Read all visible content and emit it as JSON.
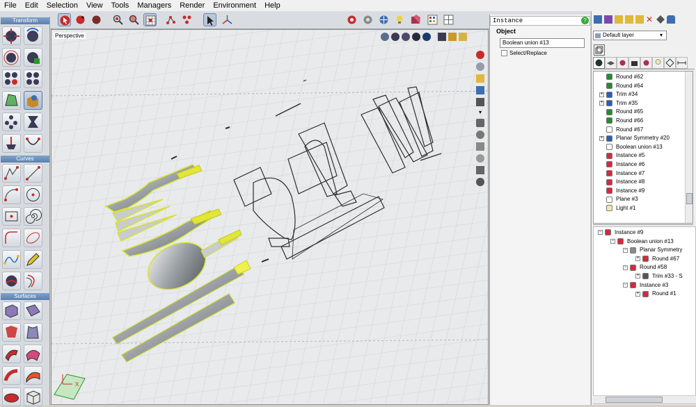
{
  "menu": {
    "items": [
      "File",
      "Edit",
      "Selection",
      "View",
      "Tools",
      "Managers",
      "Render",
      "Environment",
      "Help"
    ]
  },
  "toolbar_left": {
    "sections": [
      {
        "label": "Transform"
      },
      {
        "label": "Curves"
      },
      {
        "label": "Surfaces"
      }
    ]
  },
  "viewport": {
    "label": "Perspective"
  },
  "instance_panel": {
    "title": "Instance",
    "object_label": "Object",
    "object_name": "Boolean union #13",
    "select_replace": "Select/Replace"
  },
  "right_panel": {
    "layer": "Default layer",
    "browser_items": [
      {
        "label": "Round #62",
        "icon": "arrow-icon",
        "color": "#1e8f2d",
        "expand": false
      },
      {
        "label": "Round #64",
        "icon": "arrow-icon",
        "color": "#1e8f2d",
        "expand": false
      },
      {
        "label": "Trim #34",
        "icon": "trim-icon",
        "color": "#2a5fb8",
        "expand": true
      },
      {
        "label": "Trim #35",
        "icon": "trim-icon",
        "color": "#2a5fb8",
        "expand": true
      },
      {
        "label": "Round #65",
        "icon": "arrow-icon",
        "color": "#1e8f2d",
        "expand": false
      },
      {
        "label": "Round #66",
        "icon": "arrow-icon",
        "color": "#1e8f2d",
        "expand": false
      },
      {
        "label": "Round #67",
        "icon": "square-icon",
        "color": "#ffffff",
        "expand": false
      },
      {
        "label": "Planar Symmetry #20",
        "icon": "planar-icon",
        "color": "#2a5fb8",
        "expand": true
      },
      {
        "label": "Boolean union #13",
        "icon": "square-icon",
        "color": "#ffffff",
        "expand": false
      },
      {
        "label": "Instance #5",
        "icon": "cube-icon",
        "color": "#d8283d",
        "expand": false
      },
      {
        "label": "Instance #6",
        "icon": "cube-icon",
        "color": "#d8283d",
        "expand": false
      },
      {
        "label": "Instance #7",
        "icon": "cube-icon",
        "color": "#d8283d",
        "expand": false
      },
      {
        "label": "Instance #8",
        "icon": "cube-icon",
        "color": "#d8283d",
        "expand": false
      },
      {
        "label": "Instance #9",
        "icon": "cube-icon",
        "color": "#d8283d",
        "expand": false
      },
      {
        "label": "Plane #3",
        "icon": "square-icon",
        "color": "#ffffff",
        "expand": false
      },
      {
        "label": "Light #1",
        "icon": "light-icon",
        "color": "#f2e9a8",
        "expand": false
      }
    ],
    "history_items": [
      {
        "label": "Instance #9",
        "level": 0
      },
      {
        "label": "Boolean union #13",
        "level": 1
      },
      {
        "label": "Planar Symmetry",
        "level": 2
      },
      {
        "label": "Round #67",
        "level": 3
      },
      {
        "label": "Round #58",
        "level": 2
      },
      {
        "label": "Trim #33 - S",
        "level": 3
      },
      {
        "label": "Instance #3",
        "level": 2
      },
      {
        "label": "Round #1",
        "level": 3
      }
    ]
  }
}
